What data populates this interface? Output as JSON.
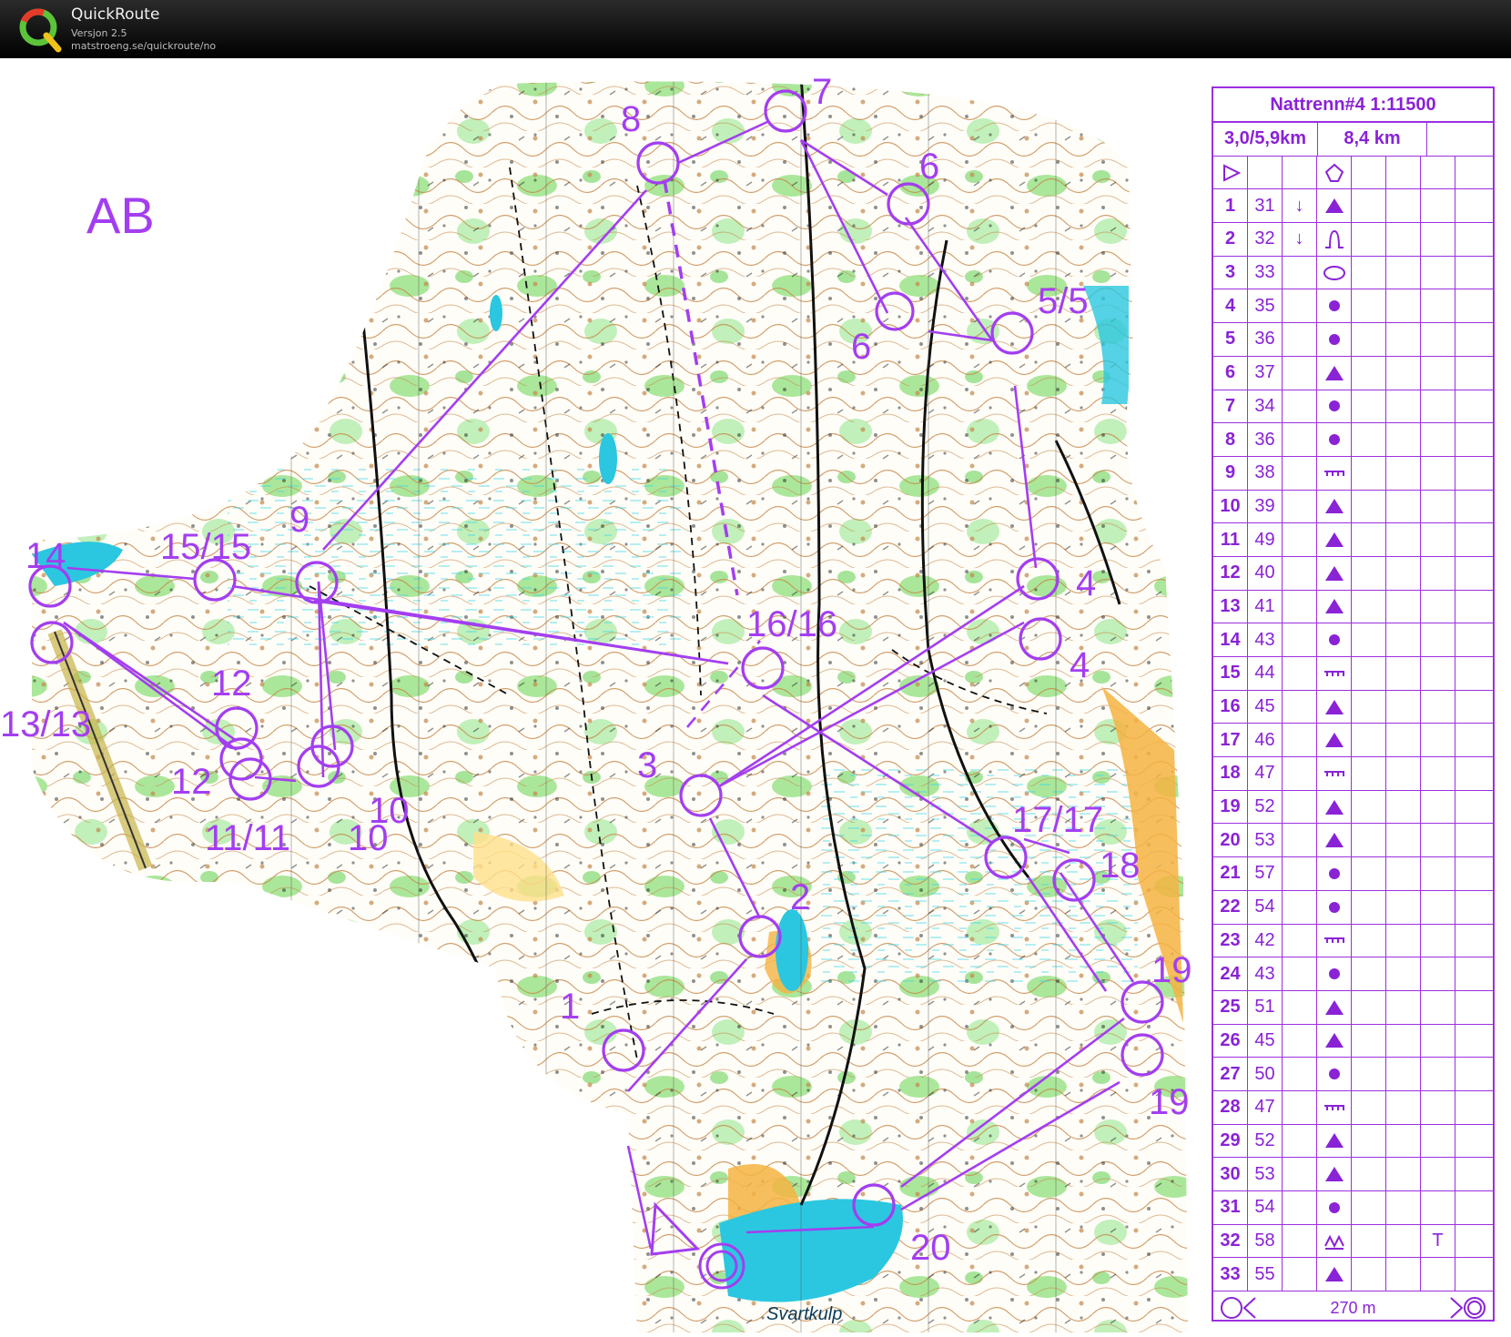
{
  "app": {
    "title": "QuickRoute",
    "version": "Versjon 2.5",
    "url": "matstroeng.se/quickroute/no"
  },
  "map": {
    "course_label": "AB",
    "place_label": "Svartkulp",
    "colors": {
      "overprint": "#a33ef0",
      "forest_open": "#ffffff",
      "green": "#7fd86a",
      "contour": "#b06a2a",
      "water": "#3ad3e8",
      "yellow": "#f5b342"
    },
    "control_labels": [
      "1",
      "2",
      "3",
      "4",
      "4",
      "5/5",
      "6",
      "6",
      "7",
      "8",
      "9",
      "10",
      "10",
      "11/11",
      "12",
      "12",
      "13/13",
      "14",
      "15/15",
      "16/16",
      "17/17",
      "18",
      "19",
      "19",
      "20"
    ]
  },
  "description_sheet": {
    "title": "Nattrenn#4 1:11500",
    "length_info": "3,0/5,9km",
    "total_length": "8,4 km",
    "start_symbol": "start-triangle-icon",
    "start_feature_icon": "road-junction-icon",
    "rows": [
      {
        "num": "1",
        "code": "31",
        "dir": "↓",
        "symbol": "triangle"
      },
      {
        "num": "2",
        "code": "32",
        "dir": "↓",
        "symbol": "knoll-curve"
      },
      {
        "num": "3",
        "code": "33",
        "dir": "",
        "symbol": "ellipse"
      },
      {
        "num": "4",
        "code": "35",
        "dir": "",
        "symbol": "dot"
      },
      {
        "num": "5",
        "code": "36",
        "dir": "",
        "symbol": "dot"
      },
      {
        "num": "6",
        "code": "37",
        "dir": "",
        "symbol": "triangle"
      },
      {
        "num": "7",
        "code": "34",
        "dir": "",
        "symbol": "dot"
      },
      {
        "num": "8",
        "code": "36",
        "dir": "",
        "symbol": "dot"
      },
      {
        "num": "9",
        "code": "38",
        "dir": "",
        "symbol": "cliff"
      },
      {
        "num": "10",
        "code": "39",
        "dir": "",
        "symbol": "triangle"
      },
      {
        "num": "11",
        "code": "49",
        "dir": "",
        "symbol": "triangle"
      },
      {
        "num": "12",
        "code": "40",
        "dir": "",
        "symbol": "triangle"
      },
      {
        "num": "13",
        "code": "41",
        "dir": "",
        "symbol": "triangle"
      },
      {
        "num": "14",
        "code": "43",
        "dir": "",
        "symbol": "dot"
      },
      {
        "num": "15",
        "code": "44",
        "dir": "",
        "symbol": "cliff"
      },
      {
        "num": "16",
        "code": "45",
        "dir": "",
        "symbol": "triangle"
      },
      {
        "num": "17",
        "code": "46",
        "dir": "",
        "symbol": "triangle"
      },
      {
        "num": "18",
        "code": "47",
        "dir": "",
        "symbol": "cliff"
      },
      {
        "num": "19",
        "code": "52",
        "dir": "",
        "symbol": "triangle"
      },
      {
        "num": "20",
        "code": "53",
        "dir": "",
        "symbol": "triangle"
      },
      {
        "num": "21",
        "code": "57",
        "dir": "",
        "symbol": "dot"
      },
      {
        "num": "22",
        "code": "54",
        "dir": "",
        "symbol": "dot"
      },
      {
        "num": "23",
        "code": "42",
        "dir": "",
        "symbol": "cliff"
      },
      {
        "num": "24",
        "code": "43",
        "dir": "",
        "symbol": "dot"
      },
      {
        "num": "25",
        "code": "51",
        "dir": "",
        "symbol": "triangle"
      },
      {
        "num": "26",
        "code": "45",
        "dir": "",
        "symbol": "triangle"
      },
      {
        "num": "27",
        "code": "50",
        "dir": "",
        "symbol": "dot"
      },
      {
        "num": "28",
        "code": "47",
        "dir": "",
        "symbol": "cliff"
      },
      {
        "num": "29",
        "code": "52",
        "dir": "",
        "symbol": "triangle"
      },
      {
        "num": "30",
        "code": "53",
        "dir": "",
        "symbol": "triangle"
      },
      {
        "num": "31",
        "code": "54",
        "dir": "",
        "symbol": "dot"
      },
      {
        "num": "32",
        "code": "58",
        "dir": "",
        "symbol": "wall",
        "extra": "T"
      },
      {
        "num": "33",
        "code": "55",
        "dir": "",
        "symbol": "triangle"
      }
    ],
    "finish_distance": "270 m"
  }
}
